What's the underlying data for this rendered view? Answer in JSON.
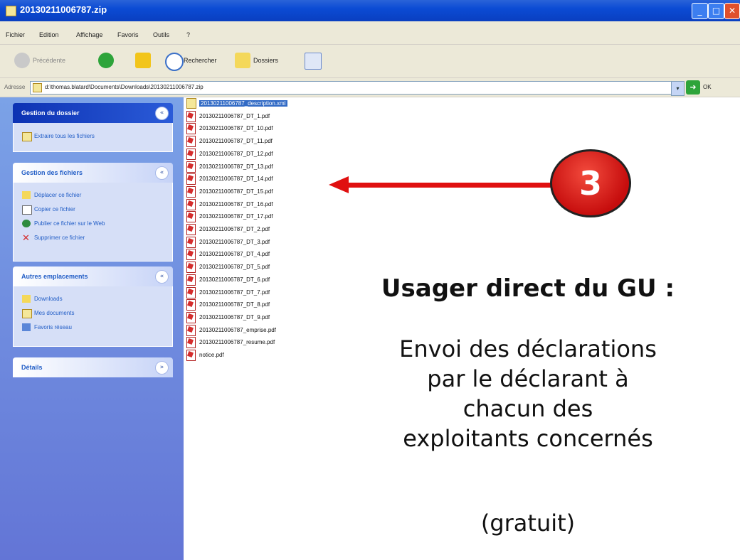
{
  "window": {
    "title": "20130211006787.zip",
    "controls": {
      "minimize": "_",
      "maximize": "□",
      "close": "✕"
    }
  },
  "menu": {
    "items": [
      "Fichier",
      "Edition",
      "Affichage",
      "Favoris",
      "Outils",
      "?"
    ]
  },
  "toolbar": {
    "back": "Précédente",
    "search": "Rechercher",
    "folders": "Dossiers"
  },
  "address": {
    "label": "Adresse",
    "path": "d:\\thomas.blatard\\Documents\\Downloads\\20130211006787.zip",
    "go": "OK"
  },
  "leftpane": {
    "folder_tasks": {
      "title": "Gestion du dossier",
      "items": [
        "Extraire tous les fichiers"
      ]
    },
    "file_tasks": {
      "title": "Gestion des fichiers",
      "items": [
        "Déplacer ce fichier",
        "Copier ce fichier",
        "Publier ce fichier sur le Web",
        "Supprimer ce fichier"
      ]
    },
    "other_places": {
      "title": "Autres emplacements",
      "items": [
        "Downloads",
        "Mes documents",
        "Favoris réseau"
      ]
    },
    "details": {
      "title": "Détails"
    }
  },
  "files": [
    "20130211006787_description.xml",
    "20130211006787_DT_1.pdf",
    "20130211006787_DT_10.pdf",
    "20130211006787_DT_11.pdf",
    "20130211006787_DT_12.pdf",
    "20130211006787_DT_13.pdf",
    "20130211006787_DT_14.pdf",
    "20130211006787_DT_15.pdf",
    "20130211006787_DT_16.pdf",
    "20130211006787_DT_17.pdf",
    "20130211006787_DT_2.pdf",
    "20130211006787_DT_3.pdf",
    "20130211006787_DT_4.pdf",
    "20130211006787_DT_5.pdf",
    "20130211006787_DT_6.pdf",
    "20130211006787_DT_7.pdf",
    "20130211006787_DT_8.pdf",
    "20130211006787_DT_9.pdf",
    "20130211006787_emprise.pdf",
    "20130211006787_resume.pdf",
    "notice.pdf"
  ],
  "slide": {
    "step": "3",
    "title": "Usager direct du GU :",
    "lines": [
      "Envoi des déclarations",
      "par le déclarant à",
      "chacun des",
      "exploitants concernés"
    ],
    "note": "(gratuit)"
  },
  "colors": {
    "accent_red": "#e01010",
    "xp_blue": "#0b4bd4",
    "selection": "#316ac5"
  }
}
